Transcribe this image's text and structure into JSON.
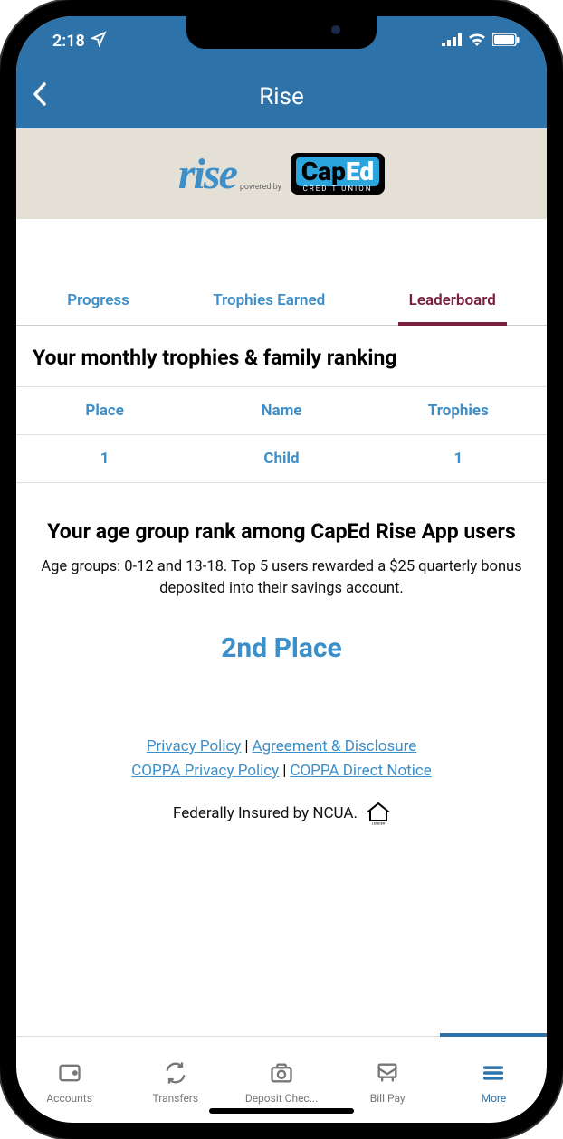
{
  "status": {
    "time": "2:18"
  },
  "header": {
    "title": "Rise"
  },
  "banner": {
    "rise_text": "rise",
    "powered": "powered by",
    "cap": "Cap",
    "ed": "Ed",
    "sub": "CREDIT UNION"
  },
  "tabs": {
    "progress": "Progress",
    "trophies": "Trophies Earned",
    "leaderboard": "Leaderboard"
  },
  "family": {
    "title": "Your monthly trophies & family ranking",
    "headers": {
      "place": "Place",
      "name": "Name",
      "trophies": "Trophies"
    },
    "rows": [
      {
        "place": "1",
        "name": "Child",
        "trophies": "1"
      }
    ]
  },
  "agegroup": {
    "title": "Your age group rank among CapEd Rise App users",
    "desc": "Age groups: 0-12 and 13-18. Top 5 users rewarded a $25 quarterly bonus deposited into their savings account.",
    "rank": "2nd Place"
  },
  "footer": {
    "privacy": "Privacy Policy",
    "agreement": "Agreement & Disclosure",
    "coppa_privacy": "COPPA Privacy Policy",
    "coppa_notice": "COPPA Direct Notice",
    "insured": "Federally Insured by NCUA."
  },
  "nav": {
    "accounts": "Accounts",
    "transfers": "Transfers",
    "deposit": "Deposit Chec...",
    "billpay": "Bill Pay",
    "more": "More"
  }
}
